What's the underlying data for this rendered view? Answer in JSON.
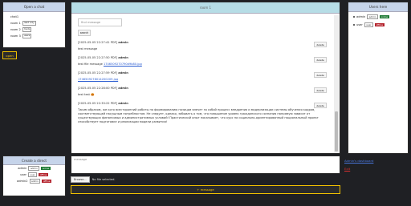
{
  "open_chat": {
    "header": "Open a chat",
    "chats": [
      {
        "name": "chat1",
        "tag": ""
      },
      {
        "name": "room 1",
        "tag": "read only"
      },
      {
        "name": "room 2",
        "tag": "mods"
      },
      {
        "name": "room 3",
        "tag": "users"
      }
    ],
    "open_button": "open"
  },
  "create_direct": {
    "header": "Create a direct",
    "users": [
      {
        "name": "admin",
        "role": "admin",
        "status": "online"
      },
      {
        "name": "user",
        "role": "user",
        "status": "offline"
      },
      {
        "name": "admin2",
        "role": "admin",
        "status": "offline"
      }
    ]
  },
  "chat": {
    "header": "room 1",
    "search_placeholder": "find message",
    "search_button": "search",
    "delete_label": "delete",
    "messages": [
      {
        "meta": "[2025-05-05 22:27:41 PDF]",
        "author": "admin",
        "text": "test message",
        "link": ""
      },
      {
        "meta": "[2025-05-05 22:27:50 PDF]",
        "author": "admin",
        "text": "test file message ",
        "link": "1746509270790d9b80.jpg"
      },
      {
        "meta": "[2025-05-05 22:27:59 PDF]",
        "author": "admin",
        "text": "",
        "link": "1746509278014200209.jpg"
      },
      {
        "meta": "[2025-05-05 22:28:00 PDF]",
        "author": "admin",
        "text": "test test 🎃",
        "link": ""
      },
      {
        "meta": "[2025-05-05 22:33:22 PDF]",
        "author": "admin",
        "text": "Таким образом, же кого всесторонний работы по формированию позиции влечет за собой процесс внедрения и модернизации системы обучения кадров, соответствующей насущным потребностям. Не следует, однако, забывать о том, что повышение уровня гражданского сознания напрямую зависит от существующих финансовых и административных условий! Практический опыт показывает, что курс на социально-ориентированный национальный проект способствует подготовке и реализации модели развития!",
        "link": ""
      }
    ]
  },
  "composer": {
    "placeholder": "message",
    "file_button": "Browse...",
    "file_status": "No file selected.",
    "send_button": "+ message"
  },
  "users_panel": {
    "header": "Users here",
    "users": [
      {
        "name": "admin",
        "role": "admin",
        "status": "online"
      },
      {
        "name": "user",
        "role": "user",
        "status": "offline"
      }
    ]
  },
  "links": {
    "dashboard": "Admin's dashboard",
    "exit": "Exit"
  },
  "colors": {
    "online": "#1e7a34",
    "offline": "#b3202a",
    "accent": "#f0c000"
  }
}
